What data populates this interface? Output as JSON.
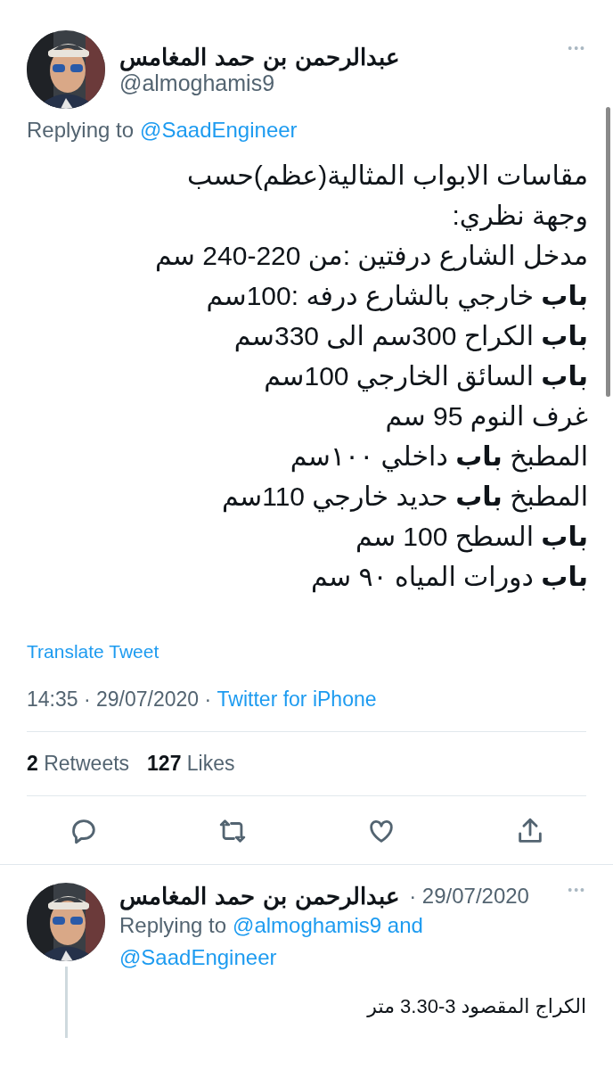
{
  "tweet": {
    "author_name": "عبدالرحمن بن حمد المغامس",
    "handle": "@almoghamis9",
    "more": "•••",
    "replying_label": "Replying to",
    "replying_to": [
      "@SaadEngineer"
    ],
    "lines": [
      "مقاسات الابواب المثالية(عظم)حسب وجهة نظري:",
      "مدخل الشارع درفتين :من 220-240 سم",
      "**باب** خارجي بالشارع درفه :100سم",
      "**باب** الكراح 300سم الى 330سم",
      "**باب** السائق الخارجي 100سم",
      "غرف النوم 95 سم",
      "المطبخ  **باب** داخلي ١٠٠سم",
      "المطبخ **باب** حديد خارجي 110سم",
      "**باب** السطح 100 سم",
      "**باب** دورات المياه ٩٠ سم"
    ],
    "translate": "Translate Tweet",
    "time": "14:35 · 29/07/2020 · ",
    "source": "Twitter for iPhone",
    "retweets": {
      "count": "2",
      "label": "Retweets"
    },
    "likes": {
      "count": "127",
      "label": "Likes"
    },
    "actions": [
      {
        "kind": "reply"
      },
      {
        "kind": "retweet"
      },
      {
        "kind": "like"
      },
      {
        "kind": "share"
      }
    ]
  },
  "reply": {
    "author_name": "عبدالرحمن بن حمد المغامس",
    "date": "· 29/07/2020",
    "more": "•••",
    "replying_label": "Replying to",
    "replying_to": [
      "@almoghamis9 and",
      "@SaadEngineer"
    ],
    "text": "الكراج المقصود 3-3.30 متر"
  }
}
